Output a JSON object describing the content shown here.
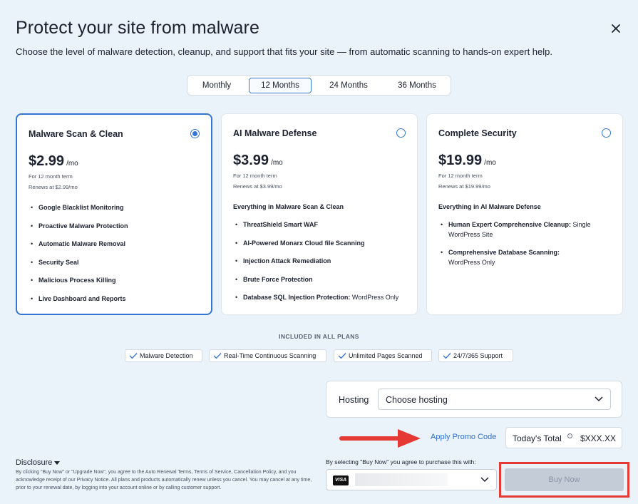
{
  "header": {
    "title": "Protect your site from malware",
    "subtitle": "Choose the level of malware detection, cleanup, and support that fits your site — from automatic scanning to hands-on expert help."
  },
  "term_options": [
    {
      "label": "Monthly",
      "selected": false
    },
    {
      "label": "12 Months",
      "selected": true
    },
    {
      "label": "24 Months",
      "selected": false
    },
    {
      "label": "36 Months",
      "selected": false
    }
  ],
  "plans": [
    {
      "name": "Malware Scan & Clean",
      "selected": true,
      "price": "$2.99",
      "per": "/mo",
      "term_note": "For 12 month term",
      "renew_note": "Renews at $2.99/mo",
      "intro": "",
      "features": [
        {
          "strong": "Google Blacklist Monitoring",
          "rest": ""
        },
        {
          "strong": "Proactive Malware Protection",
          "rest": ""
        },
        {
          "strong": "Automatic Malware Removal",
          "rest": ""
        },
        {
          "strong": "Security Seal",
          "rest": ""
        },
        {
          "strong": "Malicious Process Killing",
          "rest": ""
        },
        {
          "strong": "Live Dashboard and Reports",
          "rest": ""
        }
      ]
    },
    {
      "name": "AI Malware Defense",
      "selected": false,
      "price": "$3.99",
      "per": "/mo",
      "term_note": "For 12 month term",
      "renew_note": "Renews at $3.99/mo",
      "intro": "Everything in Malware Scan & Clean",
      "features": [
        {
          "strong": "ThreatShield Smart WAF",
          "rest": ""
        },
        {
          "strong": "AI-Powered Monarx Cloud file Scanning",
          "rest": ""
        },
        {
          "strong": "Injection Attack Remediation",
          "rest": ""
        },
        {
          "strong": "Brute Force Protection",
          "rest": ""
        },
        {
          "strong": "Database SQL Injection Protection:",
          "rest": " WordPress Only"
        }
      ]
    },
    {
      "name": "Complete Security",
      "selected": false,
      "price": "$19.99",
      "per": "/mo",
      "term_note": "For 12 month term",
      "renew_note": "Renews at $19.99/mo",
      "intro": "Everything in AI Malware Defense",
      "features": [
        {
          "strong": "Human Expert Comprehensive Cleanup:",
          "rest": " Single WordPress Site"
        },
        {
          "strong": "Comprehensive Database Scanning:",
          "rest": " WordPress Only"
        }
      ]
    }
  ],
  "included": {
    "label": "INCLUDED IN ALL PLANS",
    "items": [
      "Malware Detection",
      "Real-Time Continuous Scanning",
      "Unlimited Pages Scanned",
      "24/7/365 Support"
    ]
  },
  "hosting": {
    "label": "Hosting",
    "value": "Choose hosting"
  },
  "promo_label": "Apply Promo Code",
  "total": {
    "label": "Today's Total",
    "info": "i",
    "value": "$XXX.XX"
  },
  "disclosure": {
    "toggle": "Disclosure",
    "text": "By clicking \"Buy Now\" or \"Upgrade Now\", you agree to the Auto Renewal Terms, Terms of Service, Cancellation Policy, and you acknowledge receipt of our Privacy Notice. All plans and products automatically renew unless you cancel. You may cancel at any time, prior to your renewal date, by logging into your account online or by calling customer support."
  },
  "payment": {
    "agree_text": "By selecting \"Buy Now\" you agree to purchase this with:",
    "card_brand": "VISA"
  },
  "buy_label": "Buy Now",
  "colors": {
    "accent": "#3575d3",
    "background": "#eaf2fa",
    "highlight": "#e53935",
    "link": "#2f6fcf"
  }
}
